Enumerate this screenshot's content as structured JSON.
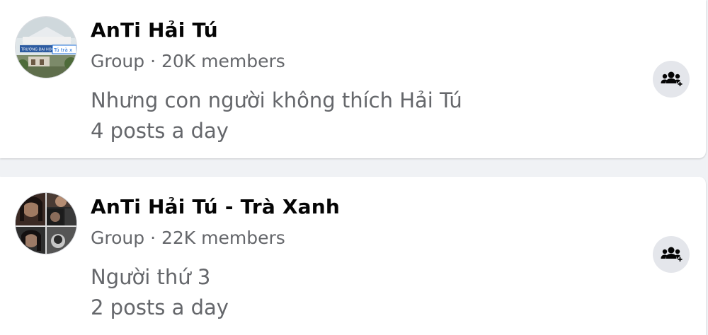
{
  "results": [
    {
      "name": "AnTi Hải Tú",
      "type": "Group",
      "separator": "·",
      "members": "20K members",
      "description": "Nhưng con người không thích Hải Tú",
      "activity": "4 posts a day",
      "avatar_sign_text": "TRƯỜNG ĐẠI HỌC HẢI",
      "avatar_sign_overlay": "Tú trà x",
      "join_icon": "group-join-icon"
    },
    {
      "name": "AnTi Hải Tú - Trà Xanh",
      "type": "Group",
      "separator": "·",
      "members": "22K members",
      "description": "Người thứ 3",
      "activity": "2 posts a day",
      "join_icon": "group-join-icon"
    }
  ],
  "colors": {
    "background": "#f0f2f5",
    "card": "#ffffff",
    "primary_text": "#050505",
    "secondary_text": "#65676b",
    "button_bg": "#e4e6eb",
    "icon": "#050505"
  }
}
